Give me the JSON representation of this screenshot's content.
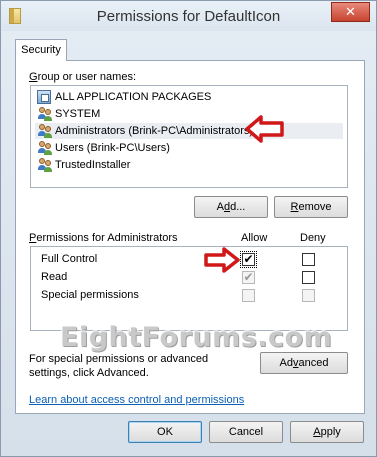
{
  "window": {
    "title": "Permissions for DefaultIcon",
    "close_glyph": "✕"
  },
  "tabs": [
    {
      "label": "Security"
    }
  ],
  "group": {
    "label": "Group or user names:",
    "items": [
      {
        "label": "ALL APPLICATION PACKAGES",
        "icon": "package-icon"
      },
      {
        "label": "SYSTEM",
        "icon": "users-icon"
      },
      {
        "label": "Administrators (Brink-PC\\Administrators)",
        "icon": "users-icon",
        "selected": true
      },
      {
        "label": "Users (Brink-PC\\Users)",
        "icon": "users-icon"
      },
      {
        "label": "TrustedInstaller",
        "icon": "users-icon"
      }
    ]
  },
  "buttons": {
    "add": {
      "pre": "A",
      "u": "d",
      "post": "d..."
    },
    "remove": {
      "pre": "",
      "u": "R",
      "post": "emove"
    },
    "advanced": {
      "pre": "Ad",
      "u": "v",
      "post": "anced"
    },
    "ok": "OK",
    "cancel": "Cancel",
    "apply": {
      "pre": "",
      "u": "A",
      "post": "pply"
    }
  },
  "permissions": {
    "label_pre": "",
    "label_u": "P",
    "label_post": "ermissions for Administrators",
    "allow_header": "Allow",
    "deny_header": "Deny",
    "rows": [
      {
        "name": "Full Control",
        "allow": "checked",
        "deny": "unchecked"
      },
      {
        "name": "Read",
        "allow": "checked-disabled",
        "deny": "unchecked"
      },
      {
        "name": "Special permissions",
        "allow": "disabled",
        "deny": "disabled"
      }
    ]
  },
  "advanced_note": "For special permissions or advanced settings, click Advanced.",
  "learn_link": "Learn about access control and permissions",
  "watermark": "EightForums.com",
  "check_glyph": "✔",
  "colors": {
    "arrow_red": "#d01818",
    "link_blue": "#0b5fb5"
  }
}
